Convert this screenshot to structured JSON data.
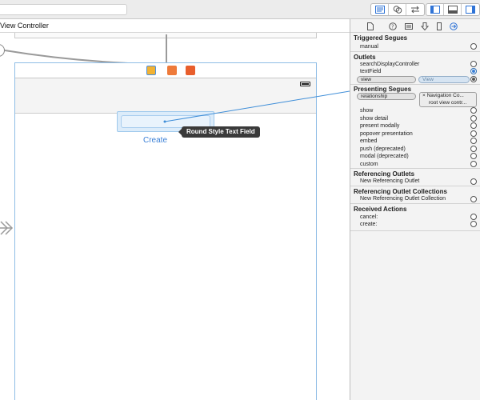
{
  "toolbar": {
    "search_value": "",
    "segments": {
      "editor": [
        "standard-editor-icon",
        "assistant-editor-icon",
        "version-editor-icon"
      ],
      "panels": [
        "navigator-panel-icon",
        "debug-panel-icon",
        "utilities-panel-icon"
      ]
    }
  },
  "canvas": {
    "jumpbar_label": "View Controller",
    "scene": {
      "dock_icons": [
        "view-controller-icon",
        "first-responder-icon",
        "exit-icon"
      ],
      "textfield_tooltip": "Round Style Text Field",
      "create_label": "Create"
    },
    "colors": {
      "scene_border": "#8fbde6",
      "link_blue": "#3a7fd6",
      "connection_line": "#3f8ed8"
    }
  },
  "inspector": {
    "tabs": [
      "file-inspector-icon",
      "quick-help-icon",
      "identity-inspector-icon",
      "attributes-inspector-icon",
      "size-inspector-icon",
      "connections-inspector-icon"
    ],
    "sections": [
      {
        "title": "Triggered Segues",
        "rows": [
          {
            "label": "manual"
          }
        ]
      },
      {
        "title": "Outlets",
        "rows": [
          {
            "label": "searchDisplayController"
          },
          {
            "label": "textField"
          },
          {
            "label": "view",
            "connected_to": "View"
          }
        ]
      },
      {
        "title": "Presenting Segues",
        "rows": [
          {
            "label": "relationship",
            "connected_to": "Navigation Co...",
            "sub": "root view contr..."
          },
          {
            "label": "show"
          },
          {
            "label": "show detail"
          },
          {
            "label": "present modally"
          },
          {
            "label": "popover presentation"
          },
          {
            "label": "embed"
          },
          {
            "label": "push (deprecated)"
          },
          {
            "label": "modal (deprecated)"
          },
          {
            "label": "custom"
          }
        ]
      },
      {
        "title": "Referencing Outlets",
        "rows": [
          {
            "label": "New Referencing Outlet"
          }
        ]
      },
      {
        "title": "Referencing Outlet Collections",
        "rows": [
          {
            "label": "New Referencing Outlet Collection"
          }
        ]
      },
      {
        "title": "Received Actions",
        "rows": [
          {
            "label": "cancel:"
          },
          {
            "label": "create:"
          }
        ]
      }
    ]
  }
}
